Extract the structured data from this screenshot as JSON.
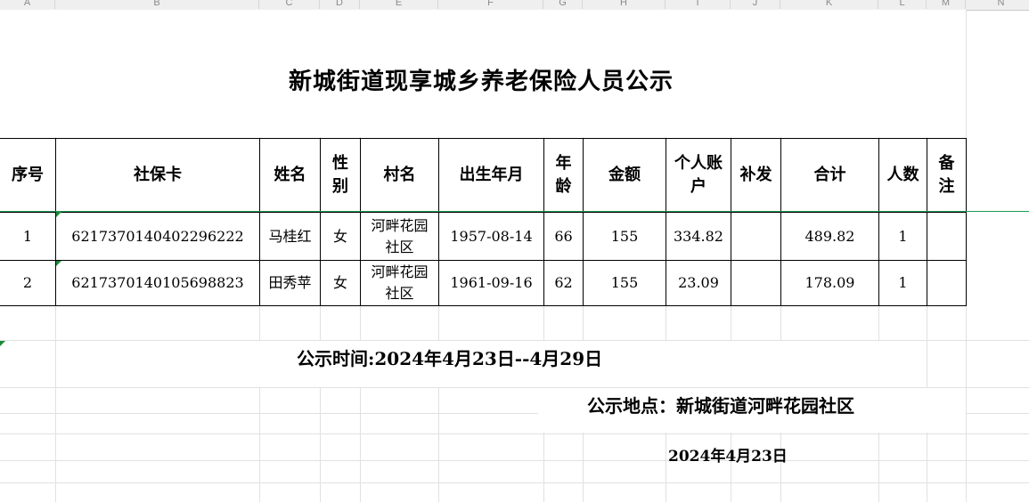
{
  "columns": [
    "A",
    "B",
    "C",
    "D",
    "E",
    "F",
    "G",
    "H",
    "I",
    "J",
    "K",
    "L",
    "M",
    "N"
  ],
  "title": "新城街道现享城乡养老保险人员公示",
  "table": {
    "headers": [
      {
        "lines": [
          "序号"
        ]
      },
      {
        "lines": [
          "社保卡"
        ]
      },
      {
        "lines": [
          "姓名"
        ]
      },
      {
        "lines": [
          "性",
          "别"
        ]
      },
      {
        "lines": [
          "村名"
        ]
      },
      {
        "lines": [
          "出生年月"
        ]
      },
      {
        "lines": [
          "年",
          "龄"
        ]
      },
      {
        "lines": [
          "金额"
        ]
      },
      {
        "lines": [
          "个人账",
          "户"
        ]
      },
      {
        "lines": [
          "补发"
        ]
      },
      {
        "lines": [
          "合计"
        ]
      },
      {
        "lines": [
          "人数"
        ]
      },
      {
        "lines": [
          "备",
          "注"
        ]
      }
    ],
    "rows": [
      {
        "seq": "1",
        "card": "6217370140402296222",
        "name": "马桂红",
        "gender": "女",
        "village": [
          "河畔花园",
          "社区"
        ],
        "birth": "1957-08-14",
        "age": "66",
        "amount": "155",
        "account": "334.82",
        "reissue": "",
        "total": "489.82",
        "count": "1",
        "note": ""
      },
      {
        "seq": "2",
        "card": "6217370140105698823",
        "name": "田秀苹",
        "gender": "女",
        "village": [
          "河畔花园",
          "社区"
        ],
        "birth": "1961-09-16",
        "age": "62",
        "amount": "155",
        "account": "23.09",
        "reissue": "",
        "total": "178.09",
        "count": "1",
        "note": ""
      }
    ]
  },
  "footer": {
    "period": "公示时间:2024年4月23日--4月29日",
    "location": "公示地点：新城街道河畔花园社区",
    "date": "2024年4月23日"
  },
  "colors": {
    "gridline": "#e1e1e1",
    "border": "#000000",
    "selection_line": "#1f9a5a",
    "error_marker": "#1b8a3a"
  }
}
